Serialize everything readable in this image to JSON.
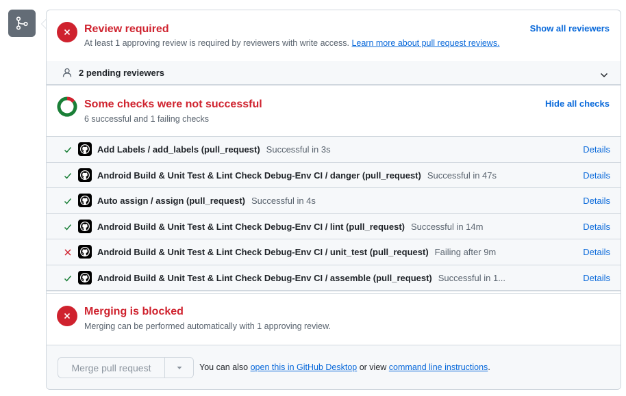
{
  "timeline": {
    "icon": "git-merge-icon"
  },
  "review": {
    "title": "Review required",
    "subtitle": "At least 1 approving review is required by reviewers with write access.",
    "learn_more_link": "Learn more about pull request reviews.",
    "show_all_link": "Show all reviewers",
    "status_icon": "x-circle-icon"
  },
  "reviewers": {
    "label": "2 pending reviewers",
    "icon": "person-icon",
    "expand_icon": "chevron-down-icon"
  },
  "checks": {
    "title": "Some checks were not successful",
    "subtitle": "6 successful and 1 failing checks",
    "hide_all_link": "Hide all checks",
    "summary": {
      "successful": 6,
      "failing": 1
    },
    "colors": {
      "success": "#1a7f37",
      "failure": "#cf222e"
    },
    "items": [
      {
        "status": "success",
        "name": "Add Labels / add_labels (pull_request)",
        "duration": "Successful in 3s",
        "details": "Details"
      },
      {
        "status": "success",
        "name": "Android Build & Unit Test & Lint Check Debug-Env CI / danger (pull_request)",
        "duration": "Successful in 47s",
        "details": "Details"
      },
      {
        "status": "success",
        "name": "Auto assign / assign (pull_request)",
        "duration": "Successful in 4s",
        "details": "Details"
      },
      {
        "status": "success",
        "name": "Android Build & Unit Test & Lint Check Debug-Env CI / lint (pull_request)",
        "duration": "Successful in 14m",
        "details": "Details"
      },
      {
        "status": "failure",
        "name": "Android Build & Unit Test & Lint Check Debug-Env CI / unit_test (pull_request)",
        "duration": "Failing after 9m",
        "details": "Details"
      },
      {
        "status": "success",
        "name": "Android Build & Unit Test & Lint Check Debug-Env CI / assemble (pull_request)",
        "duration": "Successful in 1...",
        "details": "Details"
      }
    ]
  },
  "merge": {
    "title": "Merging is blocked",
    "subtitle": "Merging can be performed automatically with 1 approving review.",
    "button_label": "Merge pull request",
    "text_before": "You can also ",
    "desktop_link": "open this in GitHub Desktop",
    "text_middle": " or view ",
    "cli_link": "command line instructions",
    "text_after": "."
  }
}
